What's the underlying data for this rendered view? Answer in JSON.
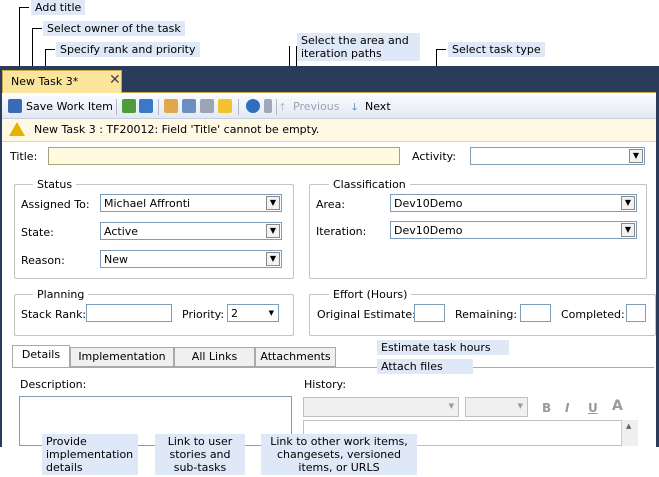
{
  "callouts": {
    "add_title": "Add title",
    "select_owner": "Select owner of the task",
    "specify_rank": "Specify rank and priority",
    "select_area": "Select the area and iteration paths",
    "select_type": "Select task type",
    "estimate": "Estimate task hours",
    "attach": "Attach files",
    "impl_details": "Provide implementation details",
    "link_stories": "Link to user stories and sub-tasks",
    "link_other": "Link to other work items, changesets, versioned items, or URLS"
  },
  "tab": {
    "title": "New Task 3*",
    "close": "✕"
  },
  "toolbar": {
    "save": "Save Work Item",
    "previous": "Previous",
    "next": "Next",
    "prev_arrow": "🡑",
    "next_arrow": "🡓"
  },
  "warning": "New Task 3 : TF20012: Field 'Title' cannot be empty.",
  "form": {
    "title_label": "Title:",
    "activity_label": "Activity:",
    "status": {
      "header": "Status",
      "assigned_label": "Assigned To:",
      "assigned_value": "Michael Affronti",
      "state_label": "State:",
      "state_value": "Active",
      "reason_label": "Reason:",
      "reason_value": "New"
    },
    "classification": {
      "header": "Classification",
      "area_label": "Area:",
      "area_value": "Dev10Demo",
      "iteration_label": "Iteration:",
      "iteration_value": "Dev10Demo"
    },
    "planning": {
      "header": "Planning",
      "rank_label": "Stack Rank:",
      "priority_label": "Priority:",
      "priority_value": "2"
    },
    "effort": {
      "header": "Effort (Hours)",
      "original_label": "Original Estimate:",
      "remaining_label": "Remaining:",
      "completed_label": "Completed:"
    }
  },
  "tabs": [
    "Details",
    "Implementation",
    "All Links",
    "Attachments"
  ],
  "details": {
    "description_label": "Description:",
    "history_label": "History:",
    "fmt_bold": "B",
    "fmt_italic": "I",
    "fmt_underline": "U",
    "fmt_font": "A"
  },
  "colors": {
    "callout_bg": "#dfe8f6",
    "frame": "#2b3c5a",
    "tab": "#fbe49b",
    "title_field": "#fffbe0"
  }
}
